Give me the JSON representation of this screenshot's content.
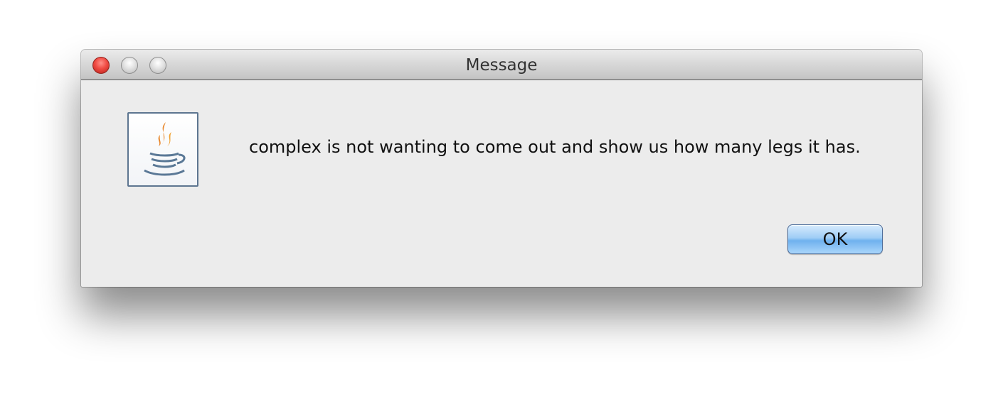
{
  "window": {
    "title": "Message"
  },
  "dialog": {
    "message": "complex is not wanting to come out and show us how many legs it has.",
    "ok_label": "OK",
    "icon": "java-icon"
  },
  "colors": {
    "close_button": "#f04b43",
    "ok_button": "#9fcdf6",
    "background": "#ececec"
  }
}
